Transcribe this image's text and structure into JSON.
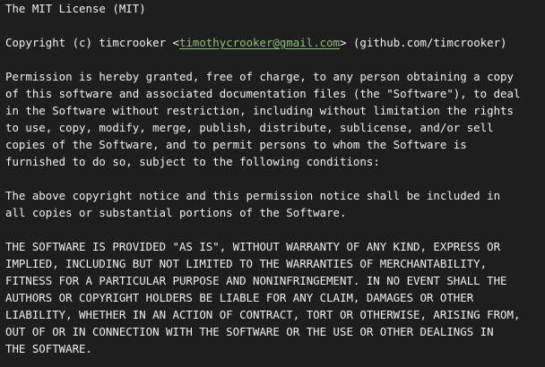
{
  "document": {
    "title": "The MIT License (MIT)",
    "copyright": {
      "prefix": "Copyright (c) timcrooker ",
      "email_open": "<",
      "email": "timothycrooker@gmail.com",
      "email_close": ">",
      "suffix": " (github.com/timcrooker)"
    },
    "paragraph1": [
      "Permission is hereby granted, free of charge, to any person obtaining a copy",
      "of this software and associated documentation files (the \"Software\"), to deal",
      "in the Software without restriction, including without limitation the rights",
      "to use, copy, modify, merge, publish, distribute, sublicense, and/or sell",
      "copies of the Software, and to permit persons to whom the Software is",
      "furnished to do so, subject to the following conditions:"
    ],
    "paragraph2": [
      "The above copyright notice and this permission notice shall be included in",
      "all copies or substantial portions of the Software."
    ],
    "paragraph3": [
      "THE SOFTWARE IS PROVIDED \"AS IS\", WITHOUT WARRANTY OF ANY KIND, EXPRESS OR",
      "IMPLIED, INCLUDING BUT NOT LIMITED TO THE WARRANTIES OF MERCHANTABILITY,",
      "FITNESS FOR A PARTICULAR PURPOSE AND NONINFRINGEMENT. IN NO EVENT SHALL THE",
      "AUTHORS OR COPYRIGHT HOLDERS BE LIABLE FOR ANY CLAIM, DAMAGES OR OTHER",
      "LIABILITY, WHETHER IN AN ACTION OF CONTRACT, TORT OR OTHERWISE, ARISING FROM,",
      "OUT OF OR IN CONNECTION WITH THE SOFTWARE OR THE USE OR OTHER DEALINGS IN",
      "THE SOFTWARE."
    ]
  },
  "colors": {
    "background": "#1e1e1e",
    "text": "#f0f0f0",
    "link": "#8ec07c"
  }
}
